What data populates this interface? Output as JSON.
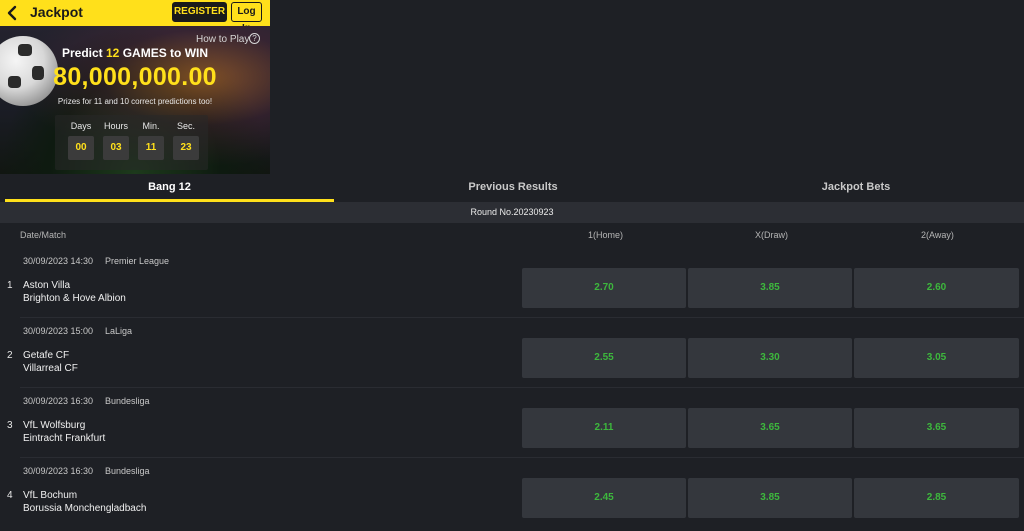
{
  "header": {
    "title": "Jackpot",
    "register_label": "REGISTER",
    "login_label": "Log In",
    "accent": "#ffe01b"
  },
  "banner": {
    "how_to_play": "How to Play",
    "predict_prefix": "Predict",
    "predict_count": "12",
    "predict_suffix": "GAMES to WIN",
    "amount": "80,000,000.00",
    "prizes_text": "Prizes for 11 and 10 correct predictions too!",
    "countdown": [
      {
        "label": "Days",
        "value": "00"
      },
      {
        "label": "Hours",
        "value": "03"
      },
      {
        "label": "Min.",
        "value": "11"
      },
      {
        "label": "Sec.",
        "value": "23"
      }
    ]
  },
  "tabs": [
    {
      "label": "Bang 12",
      "active": true
    },
    {
      "label": "Previous Results",
      "active": false
    },
    {
      "label": "Jackpot Bets",
      "active": false
    }
  ],
  "round": "Round No.20230923",
  "columns": {
    "date_match": "Date/Match",
    "home": "1(Home)",
    "draw": "X(Draw)",
    "away": "2(Away)"
  },
  "matches": [
    {
      "index": "1",
      "datetime": "30/09/2023 14:30",
      "league": "Premier League",
      "home_team": "Aston Villa",
      "away_team": "Brighton & Hove Albion",
      "odds": [
        "2.70",
        "3.85",
        "2.60"
      ]
    },
    {
      "index": "2",
      "datetime": "30/09/2023 15:00",
      "league": "LaLiga",
      "home_team": "Getafe CF",
      "away_team": "Villarreal CF",
      "odds": [
        "2.55",
        "3.30",
        "3.05"
      ]
    },
    {
      "index": "3",
      "datetime": "30/09/2023 16:30",
      "league": "Bundesliga",
      "home_team": "VfL Wolfsburg",
      "away_team": "Eintracht Frankfurt",
      "odds": [
        "2.11",
        "3.65",
        "3.65"
      ]
    },
    {
      "index": "4",
      "datetime": "30/09/2023 16:30",
      "league": "Bundesliga",
      "home_team": "VfL Bochum",
      "away_team": "Borussia Monchengladbach",
      "odds": [
        "2.45",
        "3.85",
        "2.85"
      ]
    }
  ],
  "odds_color": "#3db83d"
}
